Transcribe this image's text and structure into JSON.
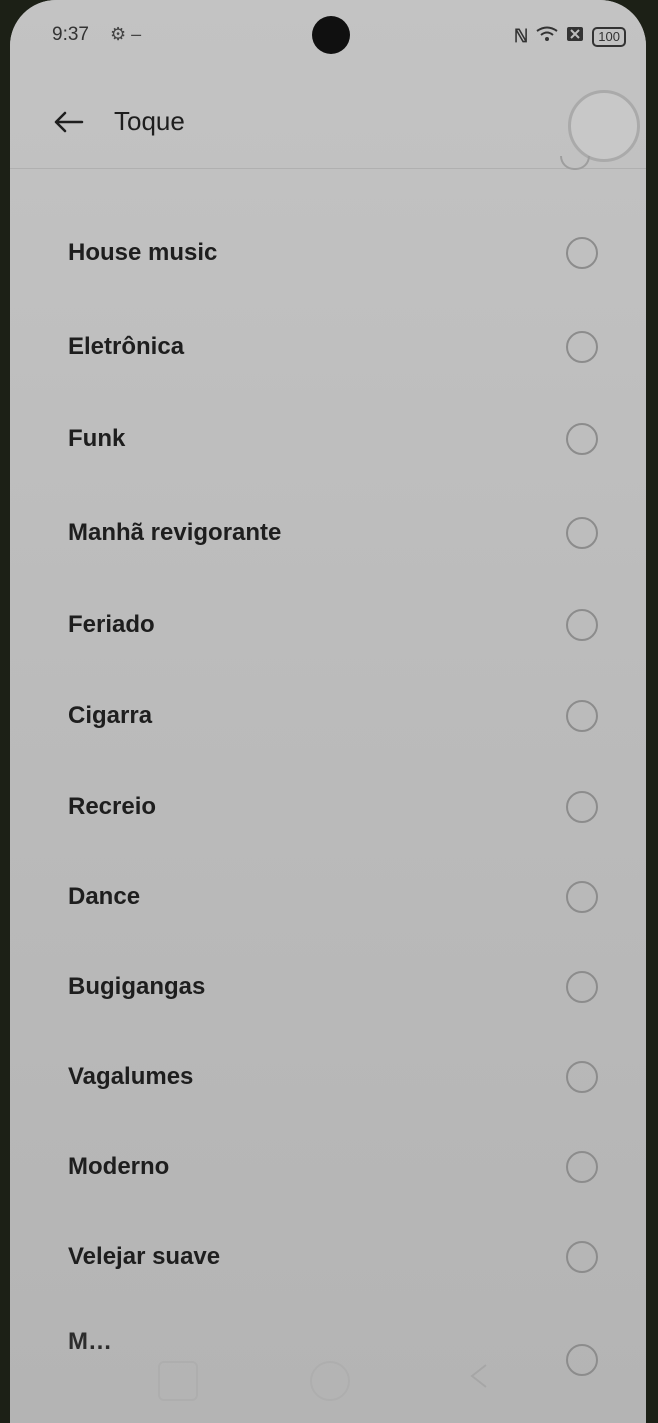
{
  "status": {
    "time": "9:37",
    "battery": "100"
  },
  "header": {
    "title": "Toque"
  },
  "ringtones": [
    {
      "label": "House music"
    },
    {
      "label": "Eletrônica"
    },
    {
      "label": "Funk"
    },
    {
      "label": "Manhã revigorante"
    },
    {
      "label": "Feriado"
    },
    {
      "label": "Cigarra"
    },
    {
      "label": "Recreio"
    },
    {
      "label": "Dance"
    },
    {
      "label": "Bugigangas"
    },
    {
      "label": "Vagalumes"
    },
    {
      "label": "Moderno"
    },
    {
      "label": "Velejar suave"
    }
  ],
  "partial_next": "M…",
  "colors": {
    "background": "#bdbdbd",
    "text": "#1e1e1e"
  }
}
